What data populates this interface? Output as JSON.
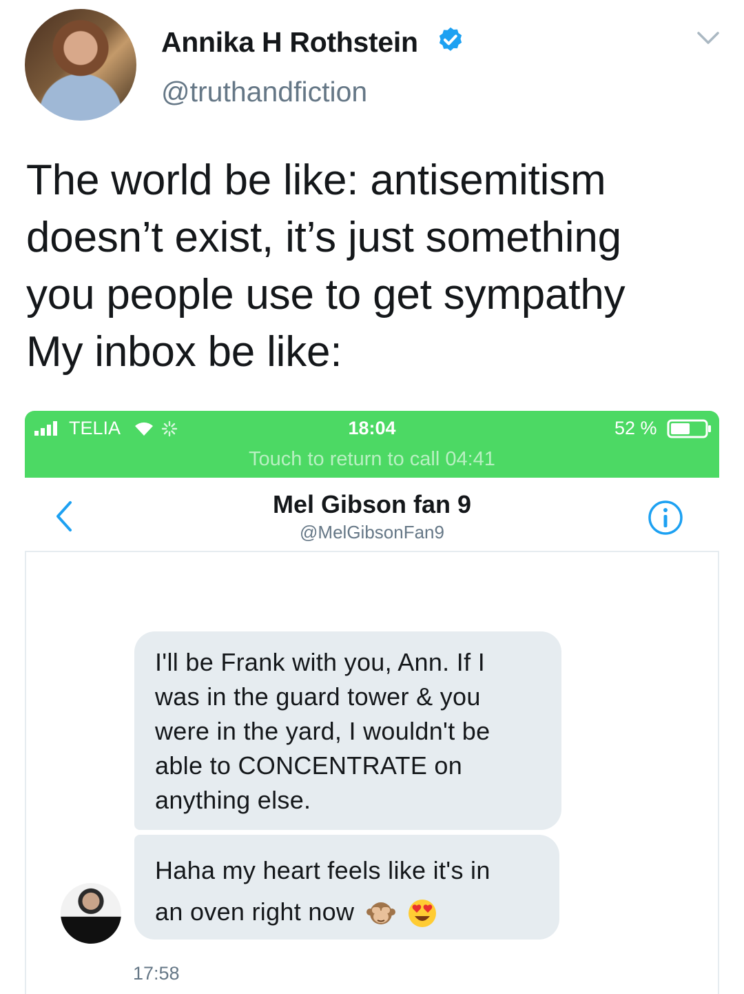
{
  "tweet": {
    "author_name": "Annika H Rothstein",
    "handle": "@truthandfiction",
    "verified": true,
    "text_lines": [
      "The world be like: antisemitism",
      "doesn’t exist, it’s just something",
      "you people use to get sympathy",
      "My inbox be like:"
    ]
  },
  "phone": {
    "status_bar": {
      "carrier": "TELIA",
      "time": "18:04",
      "battery": "52 %",
      "return_call": "Touch to return to call 04:41",
      "color": "#4cd964"
    },
    "conversation": {
      "name": "Mel Gibson fan 9",
      "handle": "@MelGibsonFan9"
    },
    "messages": [
      {
        "lines": [
          "I'll be Frank with you, Ann. If I",
          "was in the guard tower & you",
          "were in the yard, I wouldn't be",
          "able to CONCENTRATE on",
          "anything else."
        ]
      },
      {
        "lines": [
          "Haha my heart feels like it's in",
          "an oven right now"
        ],
        "emojis": [
          "see-no-evil-monkey-icon",
          "heart-eyes-icon"
        ]
      }
    ],
    "timestamp": "17:58"
  },
  "icons": {
    "verified": "verified-badge-icon",
    "menu": "chevron-down-icon",
    "back": "back-chevron-icon",
    "info": "info-icon"
  },
  "colors": {
    "twitter_blue": "#1da1f2",
    "bubble": "#e6ecf0",
    "muted": "#657786"
  }
}
